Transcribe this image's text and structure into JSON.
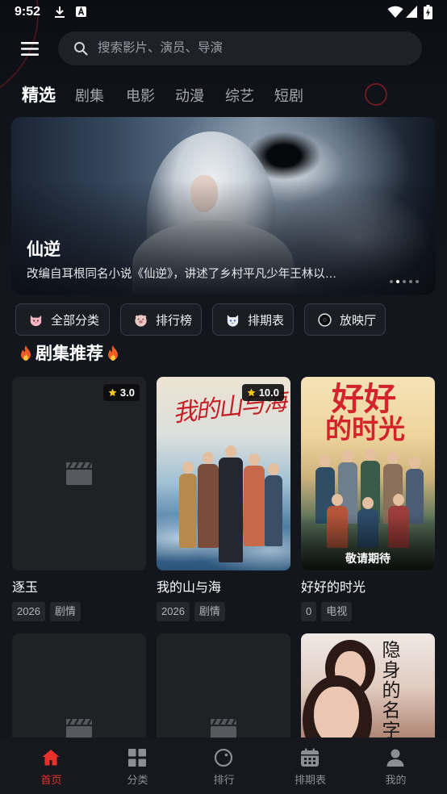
{
  "status_bar": {
    "time": "9:52",
    "left_icons": [
      "download-icon",
      "a-notification-icon"
    ],
    "right_icons": [
      "wifi-icon",
      "signal-icon",
      "battery-charging-icon"
    ]
  },
  "header": {
    "menu_icon": "menu-icon",
    "search_icon": "search-icon",
    "search_placeholder": "搜索影片、演员、导演"
  },
  "tabs": [
    {
      "label": "精选",
      "active": true
    },
    {
      "label": "剧集",
      "active": false
    },
    {
      "label": "电影",
      "active": false
    },
    {
      "label": "动漫",
      "active": false
    },
    {
      "label": "综艺",
      "active": false
    },
    {
      "label": "短剧",
      "active": false
    }
  ],
  "banner": {
    "title": "仙逆",
    "description": "改编自耳根同名小说《仙逆》，讲述了乡村平凡少年王林以…",
    "slide_count": 5,
    "active_slide": 2
  },
  "quick_links": [
    {
      "label": "全部分类",
      "icon": "pink-cat-icon"
    },
    {
      "label": "排行榜",
      "icon": "pig-face-icon"
    },
    {
      "label": "排期表",
      "icon": "cat-face-icon"
    },
    {
      "label": "放映厅",
      "icon": "circle-icon"
    }
  ],
  "section": {
    "title": "剧集推荐",
    "icon": "fire-icon"
  },
  "cards": [
    {
      "title": "逐玉",
      "rating": "3.0",
      "year": "2026",
      "genre": "剧情",
      "poster": "placeholder"
    },
    {
      "title": "我的山与海",
      "rating": "10.0",
      "year": "2026",
      "genre": "剧情",
      "poster_text": "我的山与海"
    },
    {
      "title": "好好的时光",
      "year": "0",
      "genre": "电视",
      "poster_lines": [
        "好好",
        "的时光"
      ],
      "poster_badge": "敬请期待"
    }
  ],
  "cards_row2": [
    {
      "poster": "placeholder"
    },
    {
      "poster": "placeholder"
    },
    {
      "poster_text": "隐身的名字"
    }
  ],
  "bottom_nav": [
    {
      "label": "首页",
      "icon": "home-icon",
      "active": true
    },
    {
      "label": "分类",
      "icon": "grid-icon",
      "active": false
    },
    {
      "label": "排行",
      "icon": "ranking-icon",
      "active": false
    },
    {
      "label": "排期表",
      "icon": "calendar-icon",
      "active": false
    },
    {
      "label": "我的",
      "icon": "user-icon",
      "active": false
    }
  ],
  "colors": {
    "background": "#13161d",
    "accent": "#e8322d",
    "rating_star": "#f5c518",
    "inactive": "#8b8e95"
  }
}
